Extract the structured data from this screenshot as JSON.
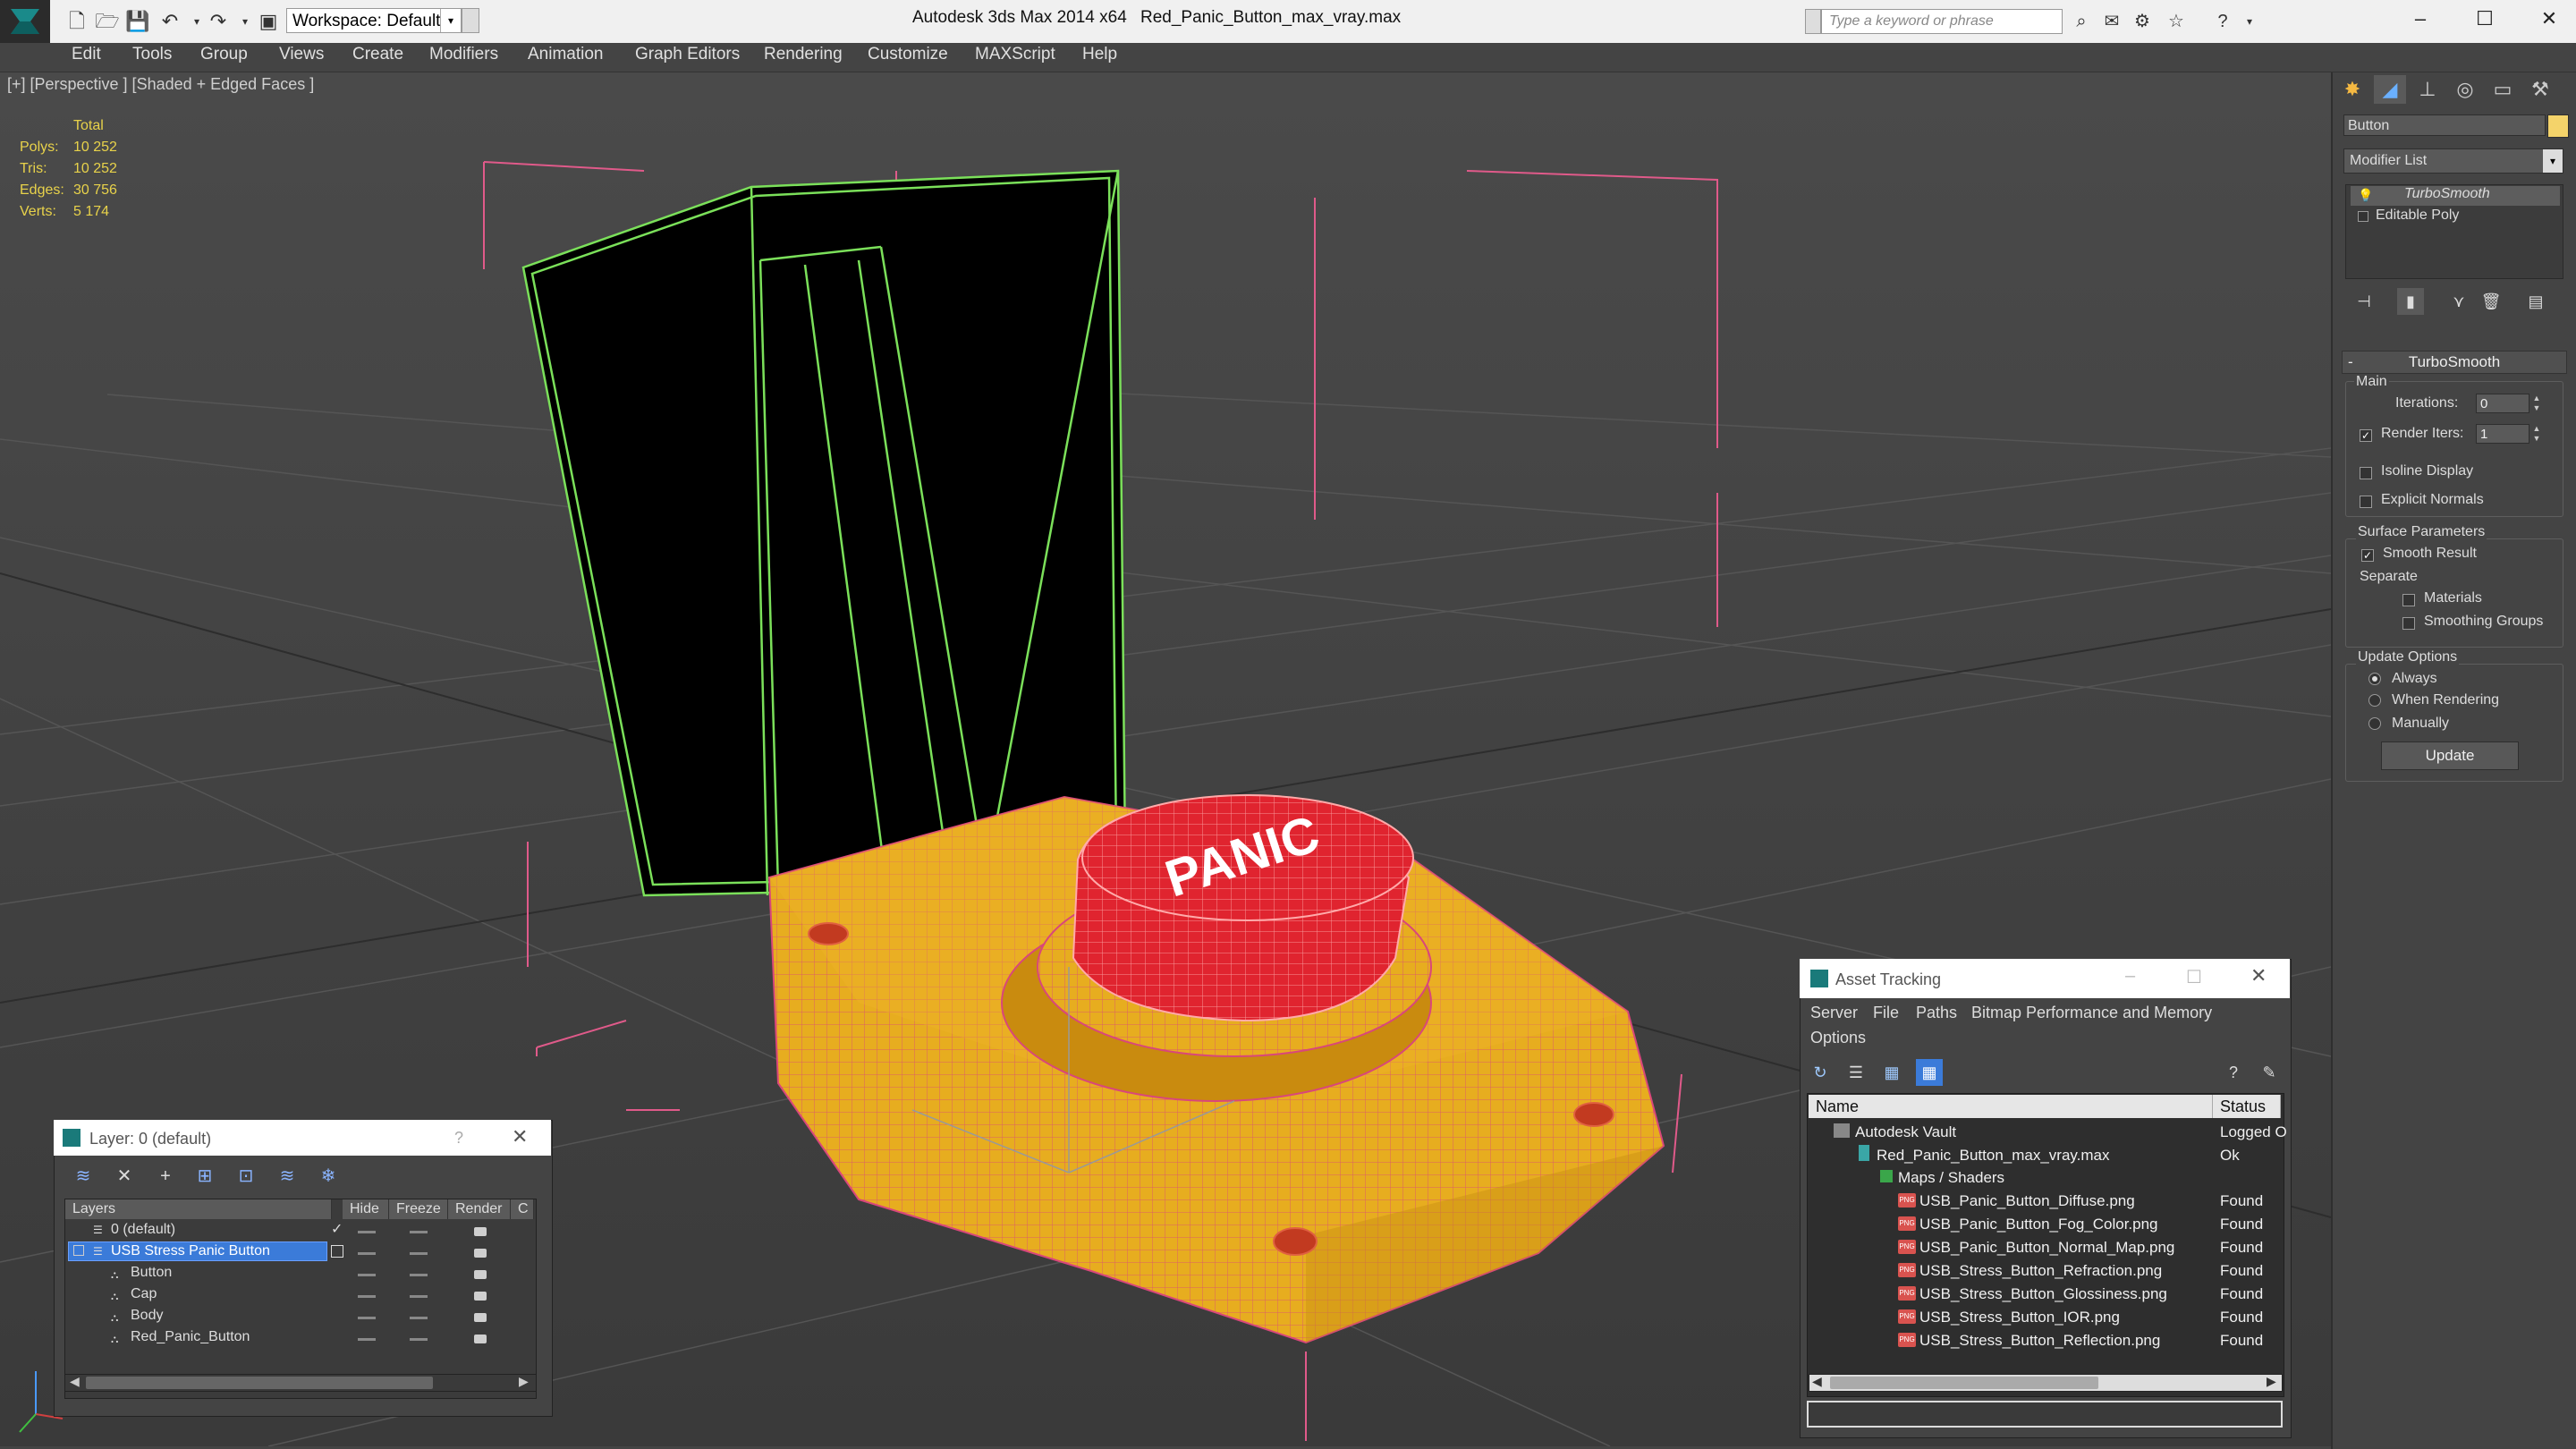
{
  "window": {
    "app_title": "Autodesk 3ds Max 2014 x64",
    "file_title": "Red_Panic_Button_max_vray.max",
    "workspace": "Workspace: Default",
    "search_placeholder": "Type a keyword or phrase"
  },
  "menu": [
    "Edit",
    "Tools",
    "Group",
    "Views",
    "Create",
    "Modifiers",
    "Animation",
    "Graph Editors",
    "Rendering",
    "Customize",
    "MAXScript",
    "Help"
  ],
  "viewport": {
    "label": "[+] [Perspective ] [Shaded + Edged Faces ]",
    "stats": {
      "header": "Total",
      "rows": [
        {
          "label": "Polys:",
          "value": "10 252"
        },
        {
          "label": "Tris:",
          "value": "10 252"
        },
        {
          "label": "Edges:",
          "value": "30 756"
        },
        {
          "label": "Verts:",
          "value": "5 174"
        }
      ]
    },
    "cap_text": "PANIC"
  },
  "command_panel": {
    "object_name": "Button",
    "object_color": "#f4d36a",
    "modifier_list": "Modifier List",
    "stack": [
      "TurboSmooth",
      "Editable Poly"
    ],
    "rollout": "TurboSmooth",
    "main_group": "Main",
    "iterations_label": "Iterations:",
    "iterations_value": "0",
    "render_iters_label": "Render Iters:",
    "render_iters_value": "1",
    "isoline_display": "Isoline Display",
    "explicit_normals": "Explicit Normals",
    "surface_parameters": "Surface Parameters",
    "smooth_result": "Smooth Result",
    "separate": "Separate",
    "materials": "Materials",
    "smoothing_groups": "Smoothing Groups",
    "update_options": "Update Options",
    "always": "Always",
    "when_rendering": "When Rendering",
    "manually": "Manually",
    "update_button": "Update"
  },
  "layer_window": {
    "title": "Layer: 0 (default)",
    "help": "?",
    "columns": [
      "Layers",
      "Hide",
      "Freeze",
      "Render",
      "C"
    ],
    "rows": [
      {
        "name": "0 (default)"
      },
      {
        "name": "USB Stress Panic Button"
      },
      {
        "name": "Button"
      },
      {
        "name": "Cap"
      },
      {
        "name": "Body"
      },
      {
        "name": "Red_Panic_Button"
      }
    ]
  },
  "asset_tracking": {
    "title": "Asset Tracking",
    "menu": [
      "Server",
      "File",
      "Paths",
      "Bitmap Performance and Memory",
      "Options"
    ],
    "columns": [
      "Name",
      "Status"
    ],
    "rows": [
      {
        "name": "Autodesk Vault",
        "status": "Logged O"
      },
      {
        "name": "Red_Panic_Button_max_vray.max",
        "status": "Ok"
      },
      {
        "name": "Maps / Shaders",
        "status": ""
      },
      {
        "name": "USB_Panic_Button_Diffuse.png",
        "status": "Found"
      },
      {
        "name": "USB_Panic_Button_Fog_Color.png",
        "status": "Found"
      },
      {
        "name": "USB_Panic_Button_Normal_Map.png",
        "status": "Found"
      },
      {
        "name": "USB_Stress_Button_Refraction.png",
        "status": "Found"
      },
      {
        "name": "USB_Stress_Button_Glossiness.png",
        "status": "Found"
      },
      {
        "name": "USB_Stress_Button_IOR.png",
        "status": "Found"
      },
      {
        "name": "USB_Stress_Button_Reflection.png",
        "status": "Found"
      }
    ]
  }
}
